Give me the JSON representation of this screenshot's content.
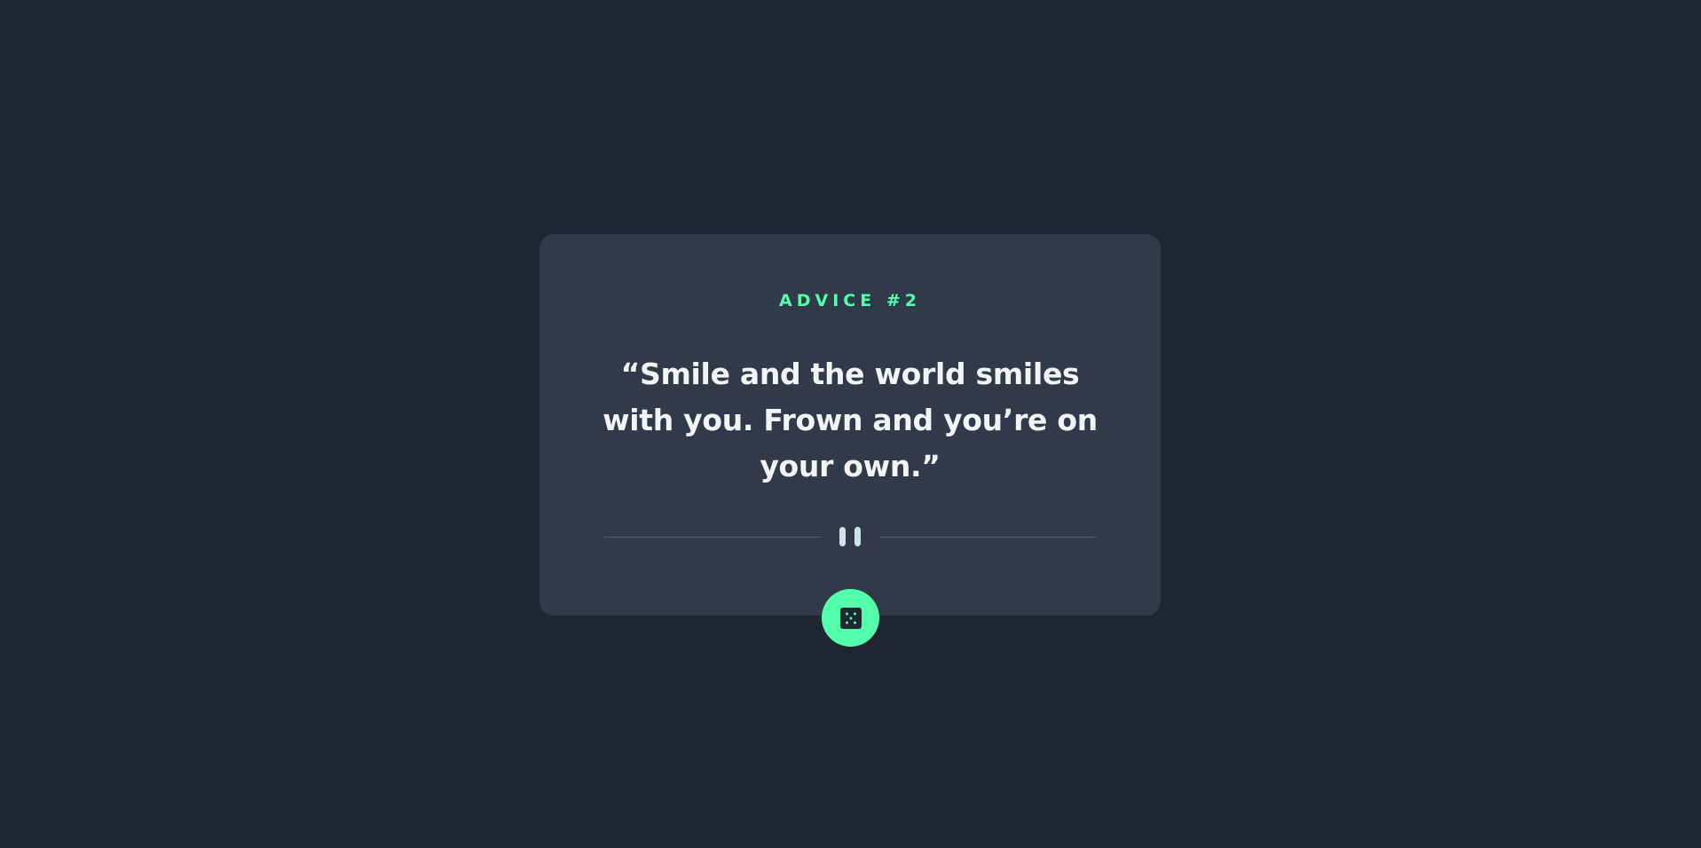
{
  "advice": {
    "label": "ADVICE #2",
    "quote": "“Smile and the world smiles with you. Frown and you’re on your own.”"
  },
  "divider": {
    "icon": "pause-icon"
  },
  "button": {
    "icon": "dice-icon",
    "color": "#53ffaa"
  },
  "colors": {
    "background": "#1f2632",
    "card": "#313a49",
    "accent": "#53ffaa",
    "quote_text": "#f1f5f8"
  }
}
